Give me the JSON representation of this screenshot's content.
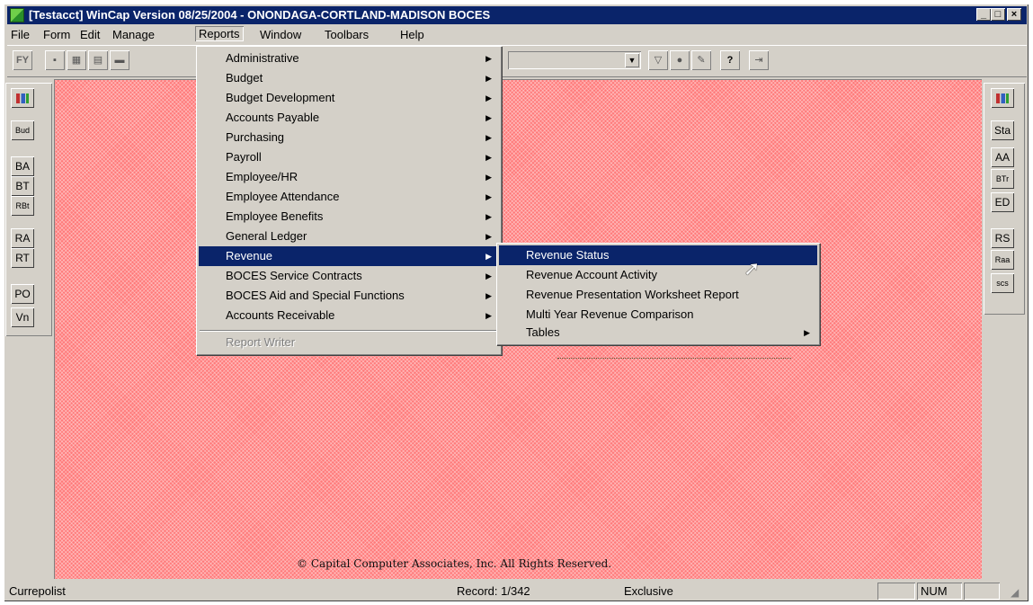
{
  "window": {
    "title": "[Testacct] WinCap Version 08/25/2004 - ONONDAGA-CORTLAND-MADISON BOCES",
    "controls": [
      "_",
      "□",
      "×"
    ]
  },
  "menubar": [
    {
      "label": "File"
    },
    {
      "label": "Form"
    },
    {
      "label": "Edit"
    },
    {
      "label": "Manage"
    },
    {
      "label": "Reports"
    },
    {
      "label": "Window"
    },
    {
      "label": "Toolbars"
    },
    {
      "label": "Help"
    }
  ],
  "reports_menu": {
    "items": [
      {
        "label": "Administrative"
      },
      {
        "label": "Budget"
      },
      {
        "label": "Budget Development"
      },
      {
        "label": "Accounts Payable"
      },
      {
        "label": "Purchasing"
      },
      {
        "label": "Payroll"
      },
      {
        "label": "Employee/HR"
      },
      {
        "label": "Employee Attendance"
      },
      {
        "label": "Employee Benefits"
      },
      {
        "label": "General Ledger"
      },
      {
        "label": "Revenue"
      },
      {
        "label": "BOCES Service Contracts"
      },
      {
        "label": "BOCES Aid and Special Functions"
      },
      {
        "label": "Accounts Receivable"
      }
    ],
    "disabled_item": "Report Writer",
    "highlighted": "Revenue"
  },
  "revenue_submenu": {
    "items": [
      {
        "label": "Revenue Status"
      },
      {
        "label": "Revenue Account Activity"
      },
      {
        "label": "Revenue Presentation Worksheet Report"
      },
      {
        "label": "Multi Year Revenue Comparison"
      },
      {
        "label": "Tables"
      }
    ],
    "highlighted": "Revenue Status"
  },
  "toolbar": {
    "fy_label": "FY",
    "help_glyph": "?",
    "combo_value": ""
  },
  "left_toolbar": [
    "Bud",
    "BA",
    "BT",
    "RBt",
    "RA",
    "RT",
    "PO",
    "Vn"
  ],
  "right_toolbar": [
    "Sta",
    "AA",
    "BTr",
    "ED",
    "RS",
    "Raa",
    "scs"
  ],
  "workspace": {
    "copyright": "© Capital Computer Associates, Inc.  All Rights Reserved."
  },
  "statusbar": {
    "left": "Currepolist",
    "record": "Record: 1/342",
    "mode": "Exclusive",
    "num": "NUM"
  },
  "colors": {
    "titlebar": "#0a246a",
    "workspace": "#ff7a7a",
    "highlight": "#0a246a"
  }
}
